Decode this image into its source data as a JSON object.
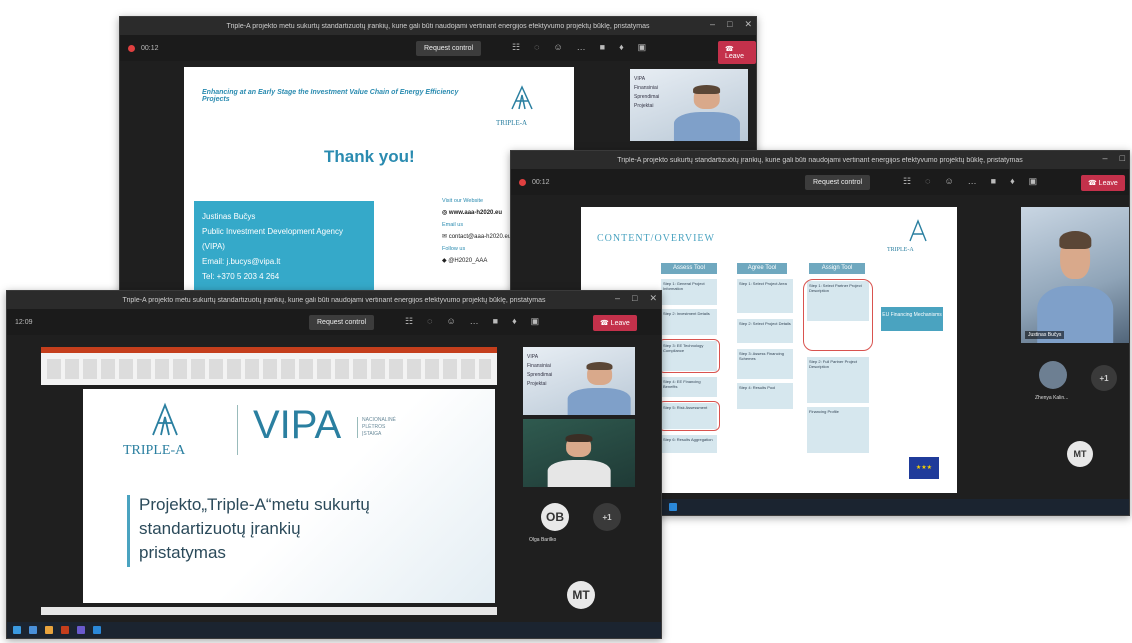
{
  "win_top": {
    "title": "Triple-A projekto metu sukurtų standartizuotų įrankių, kurie gali būti naudojami vertinant energijos efektyvumo projektų būklę, pristatymas",
    "timer": "00:12",
    "request_control": "Request control",
    "leave": "Leave",
    "slide": {
      "subtitle": "Enhancing at an Early Stage the Investment Value Chain of Energy Efficiency Projects",
      "thank_you": "Thank you!",
      "logo_text": "TRIPLE-A",
      "contact_name": "Justinas Bučys",
      "contact_org": "Public Investment Development Agency (VIPA)",
      "contact_email": "Email: j.bucys@vipa.lt",
      "contact_tel": "Tel: +370 5 203 4 264",
      "visit_label": "Visit our Website",
      "website": "www.aaa-h2020.eu",
      "email_label": "Email us",
      "email": "contact@aaa-h2020.eu",
      "follow_label": "Follow us",
      "twitter": "@H2020_AAA"
    },
    "side_text": [
      "VIPA",
      "Finansiniai",
      "Sprendimai",
      "Projektai"
    ]
  },
  "win_mid": {
    "title": "Triple-A projekto sukurtų standartizuotų įrankių, kurie gali būti naudojami vertinant energijos efektyvumo projektų būklę, pristatymas",
    "timer": "00:12",
    "request_control": "Request control",
    "leave": "Leave",
    "slide": {
      "heading": "CONTENT/OVERVIEW",
      "logo_text": "TRIPLE-A",
      "columns": [
        {
          "header": "Assess Tool",
          "boxes": [
            "Step 1: General Project Information",
            "Step 2: Investment Details",
            "Step 3: EE Technology Compliance",
            "Step 4: EE Financing Benefits",
            "Step 5: Risk Assessment",
            "Step 6: Results Aggregation"
          ]
        },
        {
          "header": "Agree Tool",
          "boxes": [
            "Step 1: Select Project Area",
            "Step 2: Select Project Details",
            "Step 3: Assess Financing Schemes",
            "Step 4: Results Pool"
          ]
        },
        {
          "header": "Assign Tool",
          "boxes": [
            "Step 1: Select Partner Project Description",
            "Step 2: Full Partner Project Description",
            "Financing Profile"
          ]
        }
      ],
      "callout": "EU Financing Mechanisms"
    },
    "video_name": "Justinas Bučys",
    "participant_name": "Zhenya Kalin...",
    "overflow_count": "+1",
    "avatar_mt": "MT"
  },
  "win_front": {
    "title": "Triple-A projekto metu sukurtų standartizuotų įrankių, kurie gali būti naudojami vertinant energijos efektyvumo projektų būklę, pristatymas",
    "timer": "12:09",
    "request_control": "Request control",
    "leave": "Leave",
    "slide": {
      "logo_text": "TRIPLE-A",
      "vipa": "VIPA",
      "vipa_sub": "NACIONALINĖ PLĖTROS ĮSTAIGA",
      "title_line1": "Projekto„Triple-A“metu sukurtų",
      "title_line2": "standartizuotų įrankių",
      "title_line3": "pristatymas"
    },
    "side_text": [
      "VIPA",
      "Finansiniai",
      "Sprendimai",
      "Projektai"
    ],
    "avatar_ob": "OB",
    "avatar_ob_name": "Olga Barilko",
    "overflow_count": "+1",
    "avatar_mt": "MT"
  },
  "colors": {
    "teal": "#4aa3c0",
    "leave_red": "#c4314b",
    "frame_dark": "#1f1f1f"
  }
}
